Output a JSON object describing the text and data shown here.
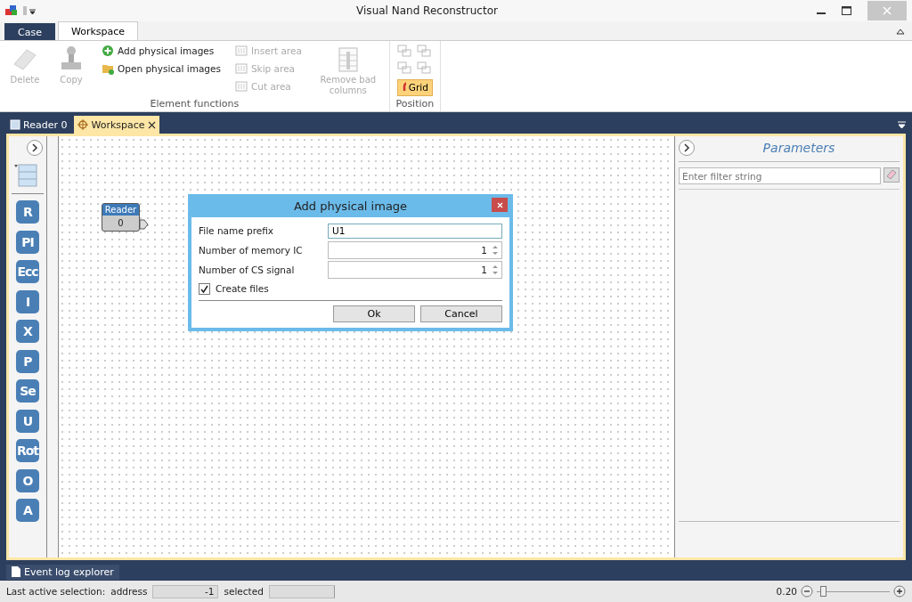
{
  "window": {
    "title": "Visual Nand Reconstructor"
  },
  "ribbon_tabs": [
    {
      "label": "Case",
      "selected": false
    },
    {
      "label": "Workspace",
      "selected": true
    }
  ],
  "ribbon_groups": [
    {
      "label": "Element functions",
      "large": [
        {
          "label": "Delete",
          "disabled": true
        },
        {
          "label": "Copy",
          "disabled": true
        }
      ],
      "small": [
        {
          "label": "Add physical images",
          "disabled": false
        },
        {
          "label": "Open physical images",
          "disabled": false
        }
      ],
      "small2": [
        {
          "label": "Insert area",
          "disabled": true
        },
        {
          "label": "Skip area",
          "disabled": true
        },
        {
          "label": "Cut area",
          "disabled": true
        }
      ],
      "large2": [
        {
          "label": "Remove bad columns",
          "disabled": true
        }
      ]
    },
    {
      "label": "Position",
      "toggle": {
        "label": "Grid",
        "on": true
      }
    }
  ],
  "doc_tabs": [
    {
      "label": "Reader 0",
      "selected": false,
      "closable": false
    },
    {
      "label": "Workspace",
      "selected": true,
      "closable": true
    }
  ],
  "palette": [
    "R",
    "PI",
    "Ecc",
    "I",
    "X",
    "P",
    "Se",
    "U",
    "Rot",
    "O",
    "A"
  ],
  "node": {
    "title": "Reader",
    "value": "0"
  },
  "dialog": {
    "title": "Add physical image",
    "fields": [
      {
        "label": "File name prefix",
        "kind": "text",
        "value": "U1"
      },
      {
        "label": "Number of memory IC",
        "kind": "spin",
        "value": "1"
      },
      {
        "label": "Number of CS signal",
        "kind": "spin",
        "value": "1"
      }
    ],
    "checkbox": {
      "label": "Create files",
      "checked": true
    },
    "buttons": [
      "Ok",
      "Cancel"
    ]
  },
  "parameters": {
    "title": "Parameters",
    "filter_placeholder": "Enter filter string"
  },
  "bottom_tab": "Event log explorer",
  "status_bar": {
    "label": "Last active selection:",
    "address_label": "address",
    "address": "-1",
    "selected_label": "selected",
    "zoom": "0.20",
    "level": 0.1
  }
}
